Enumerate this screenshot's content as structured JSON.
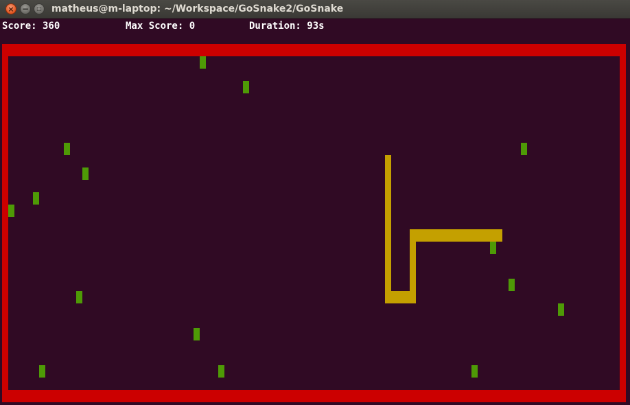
{
  "window": {
    "title": "matheus@m-laptop: ~/Workspace/GoSnake2/GoSnake",
    "close_symbol": "×",
    "minimize_symbol": "−",
    "maximize_symbol": "□"
  },
  "status": {
    "score": "Score: 360",
    "max_score": "Max Score: 0",
    "duration": "Duration: 93s"
  },
  "game": {
    "colors": {
      "background": "#300a24",
      "wall": "#cc0000",
      "food": "#4e9a06",
      "snake": "#c4a000"
    }
  }
}
